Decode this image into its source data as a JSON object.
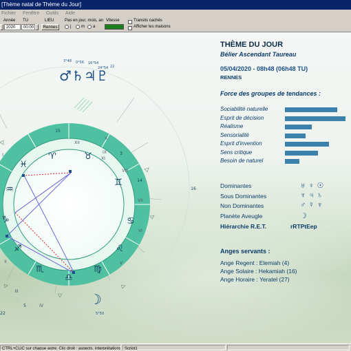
{
  "window": {
    "title": "[Thème natal de Thème du Jour]"
  },
  "menu": [
    "Fichier",
    "Fenêtre",
    "Outils",
    "Aide"
  ],
  "toolbar": {
    "annee_label": "Année",
    "annee_value": "2020",
    "tu_label": "TU",
    "tu_value": "00:00",
    "lieu_label": "LIEU",
    "lieu_value": "Rennes",
    "pas_label": "Pas en jour, mois, an",
    "pas_j": "j",
    "pas_m": "m",
    "pas_a": "a",
    "vitesse_label": "Vitesse",
    "transits_label": "Transits cachés",
    "maisons_label": "Afficher les maisons"
  },
  "chart": {
    "house_numbers": [
      "XII",
      "XI",
      "X",
      "IX",
      "VIII",
      "VII",
      "VI",
      "V",
      "IV",
      "III",
      "II",
      "I"
    ],
    "degree_labels": [
      "15",
      "3",
      "14",
      "16",
      "5",
      "22"
    ],
    "planet_annotations": [
      "3°48",
      "0°56",
      "16°54",
      "24°54",
      "22",
      "5°50"
    ],
    "moon_symbol": "☽",
    "planet_group_symbols": "♂♄♃♇"
  },
  "panel": {
    "title": "THÈME DU JOUR",
    "subtitle": "Bélier Ascendant Taureau",
    "datetime": "05/04/2020 - 08h48 (06h48 TU)",
    "place": "RENNES",
    "tendances_title": "Force des groupes de tendances :",
    "tendances": [
      {
        "label": "Sociabilité naturelle",
        "value": 0.86
      },
      {
        "label": "Esprit de décision",
        "value": 1.0
      },
      {
        "label": "Réalisme",
        "value": 0.44
      },
      {
        "label": "Sensorialité",
        "value": 0.34
      },
      {
        "label": "Esprit d'invention",
        "value": 0.73
      },
      {
        "label": "Sens critique",
        "value": 0.54
      },
      {
        "label": "Besoin de naturel",
        "value": 0.24
      }
    ],
    "dominantes": [
      {
        "label": "Dominantes",
        "glyphs": "♅♀☉"
      },
      {
        "label": "Sous Dominantes",
        "glyphs": "♆♃♄"
      },
      {
        "label": "Non Dominantes",
        "glyphs": "♂☿♆"
      },
      {
        "label": "Planète Aveugle",
        "glyphs": "☽"
      }
    ],
    "hierarchie_label": "Hiérarchie R.E.T.",
    "hierarchie_value": "rRTPtEep",
    "anges_title": "Anges servants :",
    "anges": [
      "Ange Regent : Elemiah (4)",
      "Ange Solaire : Hekamiah (16)",
      "Ange Horaire : Yeratel (27)"
    ]
  },
  "status": {
    "hint": "CTRL+CLIC sur chaque astre. Clic droit : aspects, interprétations...",
    "script": "Script1"
  },
  "colors": {
    "zodiac_ring": "#4fc1a0",
    "accent_blue": "#1b4f86",
    "bar": "#3a82ac"
  }
}
